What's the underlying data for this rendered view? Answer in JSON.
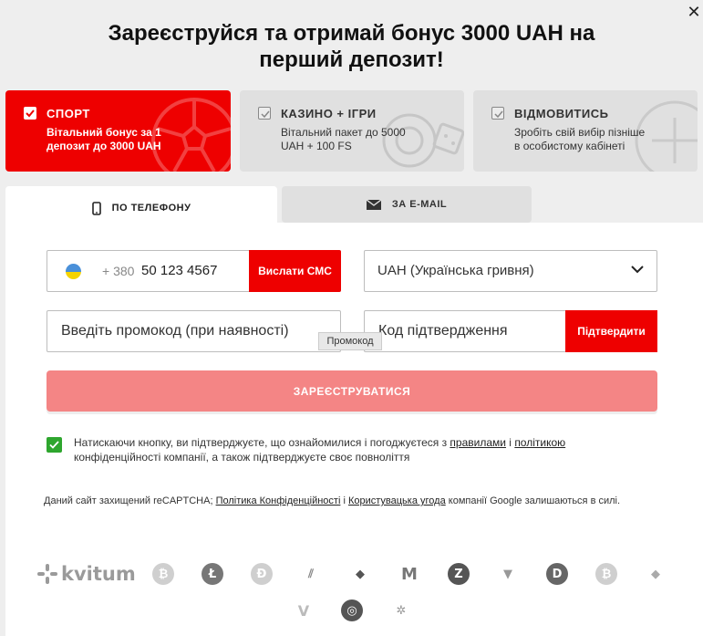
{
  "modal": {
    "close_icon": "close-icon",
    "title_line1": "Зареєструйся та отримай бонус 3000 UAH на",
    "title_line2": "перший депозит!"
  },
  "bonus_options": [
    {
      "title": "СПОРТ",
      "description": "Вітальний бонус за 1 депозит до 3000 UAH",
      "selected": true,
      "icon": "soccer-ball-icon"
    },
    {
      "title": "КАЗИНО + ІГРИ",
      "description": "Вітальний пакет до 5000 UAH + 100 FS",
      "selected": false,
      "icon": "casino-chip-icon"
    },
    {
      "title": "ВІДМОВИТИСЬ",
      "description": "Зробіть свій вибір пізніше в особистому кабінеті",
      "selected": false,
      "icon": "cross-circle-icon"
    }
  ],
  "tabs": {
    "phone": {
      "label": "ПО ТЕЛЕФОНУ",
      "icon": "phone-icon",
      "active": true
    },
    "email": {
      "label": "ЗА E-MAIL",
      "icon": "envelope-icon",
      "active": false
    }
  },
  "form": {
    "phone": {
      "flag": "ukraine-flag-icon",
      "prefix": "+ 380",
      "value": "50 123 4567",
      "send_sms_label": "Вислати СМС"
    },
    "currency": {
      "value": "UAH (Українська гривня)"
    },
    "promo": {
      "placeholder": "Введіть промокод (при наявності)",
      "tooltip": "Промокод"
    },
    "confirmation": {
      "placeholder": "Код підтвердження",
      "confirm_label": "Підтвердити"
    },
    "register_label": "ЗАРЕЄСТРУВАТИСЯ",
    "agree": {
      "checked": true,
      "text_before": "Натискаючи кнопку, ви підтверджуєте, що ознайомилися і погоджуєтеся з ",
      "link_rules": "правилами",
      "text_and": " і ",
      "link_policy": "політикою",
      "text_after": " конфіденційності компанії, а також підтверджуєте своє повноліття"
    }
  },
  "captcha": {
    "text_before": "Даний сайт захищений reCAPTCHA; ",
    "link_privacy": "Політика Конфіденційності",
    "text_and": " і ",
    "link_terms": "Користувацька угода",
    "text_after": " компанії Google залишаються в силі."
  },
  "footer": {
    "brand": "kvitum",
    "crypto_icons": [
      "bitcoin-icon",
      "litecoin-icon",
      "dogecoin-icon",
      "dash-icon",
      "ethereum-icon",
      "monero-icon",
      "zcash-icon",
      "shield-coin-icon",
      "digibyte-icon",
      "bitcoin-cash-icon",
      "ethereum-classic-icon",
      "verge-icon",
      "qtum-icon",
      "cardano-icon"
    ],
    "crypto_glyphs": [
      "₿",
      "Ł",
      "Ð",
      "⫽",
      "◆",
      "M",
      "Z",
      "▼",
      "D",
      "₿",
      "◆",
      "V",
      "◎",
      "✲"
    ]
  }
}
